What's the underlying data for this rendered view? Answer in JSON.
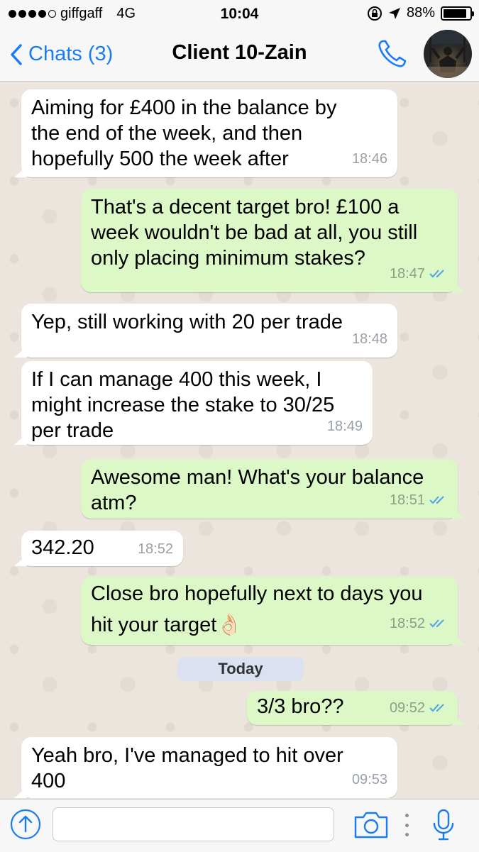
{
  "status_bar": {
    "carrier": "giffgaff",
    "network": "4G",
    "time": "10:04",
    "battery": "88%",
    "battery_level": 0.88
  },
  "header": {
    "back_label": "Chats (3)",
    "title": "Client 10-Zain"
  },
  "messages": [
    {
      "direction": "in",
      "text": "Aiming for £400 in the balance by\nthe end of the week, and then\nhopefully 500 the week after",
      "time": "18:46"
    },
    {
      "direction": "out",
      "text": "That's a decent target bro! £100 a\nweek wouldn't be bad at all, you still\nonly placing minimum stakes?",
      "time": "18:47"
    },
    {
      "direction": "in",
      "text": "Yep, still working with 20 per trade",
      "time": "18:48"
    },
    {
      "direction": "in",
      "text": "If I can manage 400 this week, I\nmight increase the stake to 30/25\nper trade",
      "time": "18:49"
    },
    {
      "direction": "out",
      "text": "Awesome man! What's your balance\natm?",
      "time": "18:51"
    },
    {
      "direction": "in",
      "text": "342.20",
      "time": "18:52"
    },
    {
      "direction": "out",
      "text": "Close bro hopefully next to days you\nhit your target",
      "emoji": "👌🏻",
      "time": "18:52"
    },
    {
      "direction": "out",
      "text": "3/3 bro??",
      "time": "09:52"
    },
    {
      "direction": "in",
      "text": "Yeah bro, I've managed to hit over\n400",
      "time": "09:53"
    }
  ],
  "date_separator": "Today",
  "colors": {
    "accent": "#1a7cf5",
    "outgoing_bubble": "#dcf8c6",
    "incoming_bubble": "#ffffff",
    "chat_background": "#ece5dd",
    "read_ticks": "#4fa3e8"
  },
  "icons": {
    "back": "chevron-left-icon",
    "call": "phone-icon",
    "upload": "upload-arrow-icon",
    "camera": "camera-icon",
    "more": "vertical-dots-icon",
    "mic": "microphone-icon"
  },
  "input": {
    "value": "",
    "placeholder": ""
  }
}
